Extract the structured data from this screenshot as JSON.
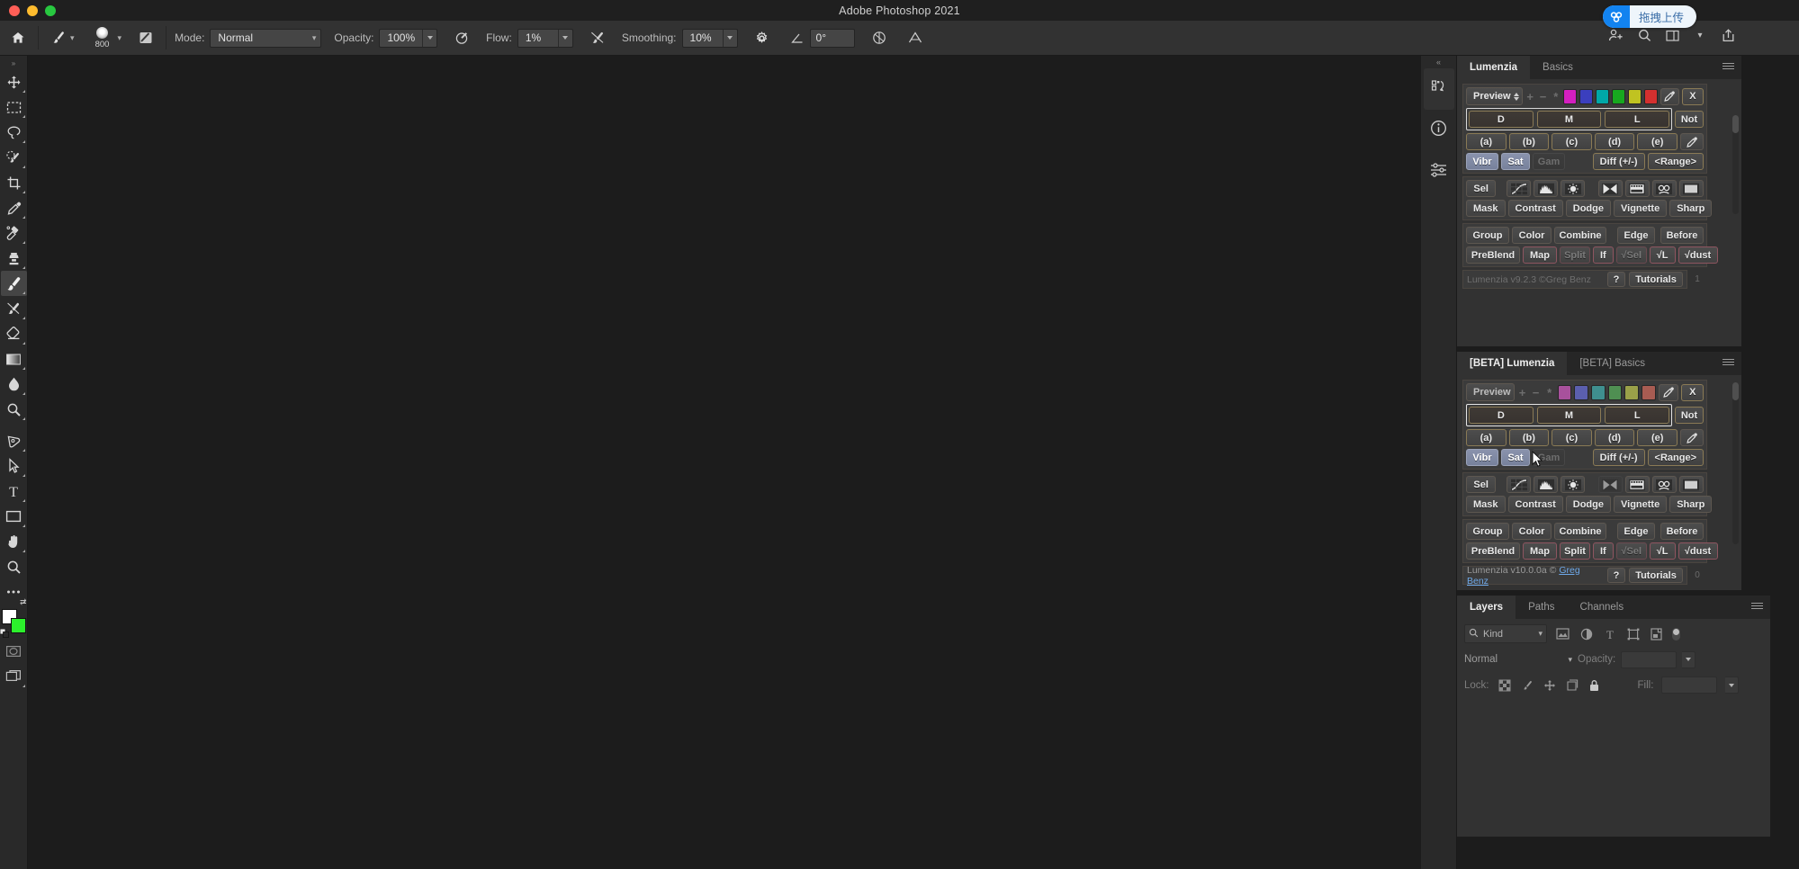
{
  "window": {
    "title": "Adobe Photoshop 2021",
    "traffic_lights": [
      "close",
      "minimize",
      "maximize"
    ]
  },
  "options_bar": {
    "home_icon": "home-icon",
    "brush_preset_icon": "brush-preset-icon",
    "brush_size": "800",
    "brush_panel_icon": "brush-settings-panel-icon",
    "mode_label": "Mode:",
    "mode_value": "Normal",
    "opacity_label": "Opacity:",
    "opacity_value": "100%",
    "pressure_opacity_icon": "pressure-controls-opacity-icon",
    "flow_label": "Flow:",
    "flow_value": "1%",
    "airbrush_icon": "airbrush-icon",
    "smoothing_label": "Smoothing:",
    "smoothing_value": "10%",
    "smoothing_options_icon": "gear-icon",
    "angle_icon": "brush-angle-icon",
    "angle_value": "0°",
    "symmetry_icon": "symmetry-icon",
    "tablet_pressure_icon": "tablet-pressure-size-icon"
  },
  "top_right": {
    "upload_label": "拖拽上传",
    "upload_brand_icon": "cloud-upload-icon",
    "icons": [
      {
        "name": "add-collaborator-icon"
      },
      {
        "name": "search-icon"
      },
      {
        "name": "workspace-switcher-icon"
      },
      {
        "name": "chevron-down-icon"
      },
      {
        "name": "share-export-icon"
      }
    ]
  },
  "toolbar": {
    "collapse_icon": "expand-toolbar-icon",
    "tools": [
      {
        "name": "move-tool",
        "icon": "move-icon",
        "active": false
      },
      {
        "name": "rectangular-marquee-tool",
        "icon": "marquee-icon",
        "active": false
      },
      {
        "name": "lasso-tool",
        "icon": "lasso-icon",
        "active": false
      },
      {
        "name": "object-selection-tool",
        "icon": "quick-selection-icon",
        "active": false
      },
      {
        "name": "crop-tool",
        "icon": "crop-icon",
        "active": false
      },
      {
        "name": "eyedropper-tool",
        "icon": "eyedropper-icon",
        "active": false
      },
      {
        "name": "spot-healing-brush-tool",
        "icon": "healing-brush-icon",
        "active": false
      },
      {
        "name": "clone-stamp-tool",
        "icon": "clone-stamp-icon",
        "active": false
      },
      {
        "name": "brush-tool",
        "icon": "brush-icon",
        "active": true
      },
      {
        "name": "history-brush-tool",
        "icon": "history-brush-icon",
        "active": false
      },
      {
        "name": "eraser-tool",
        "icon": "eraser-icon",
        "active": false
      },
      {
        "name": "gradient-tool",
        "icon": "gradient-icon",
        "active": false
      },
      {
        "name": "blur-tool",
        "icon": "blur-drop-icon",
        "active": false
      },
      {
        "name": "dodge-tool",
        "icon": "dodge-icon",
        "active": false
      },
      {
        "name": "pen-tool",
        "icon": "pen-icon",
        "active": false
      },
      {
        "name": "path-selection-tool",
        "icon": "path-arrow-icon",
        "active": false
      },
      {
        "name": "type-tool",
        "icon": "type-icon",
        "active": false
      },
      {
        "name": "rectangle-tool",
        "icon": "rectangle-icon",
        "active": false
      },
      {
        "name": "hand-tool",
        "icon": "hand-icon",
        "active": false
      },
      {
        "name": "zoom-tool",
        "icon": "magnifier-icon",
        "active": false
      },
      {
        "name": "edit-toolbar",
        "icon": "ellipsis-icon",
        "active": false
      }
    ],
    "foreground_color": "#ffffff",
    "background_color": "#2cf02c",
    "swap_colors_icon": "swap-colors-icon",
    "default_colors_icon": "default-colors-icon",
    "quick_mask_icon": "quick-mask-icon",
    "screen_mode_icon": "screen-mode-icon"
  },
  "rail": {
    "collapse_icon": "collapse-panels-icon",
    "buttons": [
      {
        "name": "actions-panel-icon",
        "selected": false
      },
      {
        "name": "info-panel-icon",
        "selected": false
      },
      {
        "name": "properties-panel-icon",
        "selected": false
      }
    ]
  },
  "lumenzia": {
    "tabs": [
      {
        "label": "Lumenzia",
        "active": true
      },
      {
        "label": "Basics",
        "active": false
      }
    ],
    "menu_icon": "panel-menu-icon",
    "preview_label": "Preview",
    "plus": "+",
    "minus": "−",
    "asterisk": "*",
    "swatch_colors": [
      "#d41fc0",
      "#3b3fbe",
      "#00a8a8",
      "#17a81f",
      "#c0c321",
      "#d4302f"
    ],
    "dropper_icon": "eyedropper-icon",
    "clear_label": "X",
    "zones": [
      "D",
      "M",
      "L"
    ],
    "not_label": "Not",
    "sublevels": [
      "(a)",
      "(b)",
      "(c)",
      "(d)",
      "(e)"
    ],
    "sample_icon": "eyedropper-icon",
    "vibr_label": "Vibr",
    "sat_label": "Sat",
    "gam_label": "Gam",
    "diff_label": "Diff (+/-)",
    "range_label": "<Range>",
    "sel_label": "Sel",
    "adjust_icons": [
      "curves-icon",
      "levels-icon",
      "brightness-contrast-icon",
      "gradient-map-icon",
      "film-strip-icon",
      "color-balance-icon",
      "solid-color-icon"
    ],
    "mask_row": [
      "Mask",
      "Contrast",
      "Dodge",
      "Vignette",
      "Sharp"
    ],
    "group_row": [
      "Group",
      "Color",
      "Combine",
      "Edge",
      "Before"
    ],
    "preblend_row": [
      "PreBlend",
      "Map",
      "Split",
      "If",
      "√Sel",
      "√L",
      "√dust"
    ],
    "version": "Lumenzia v9.2.3 ©Greg Benz",
    "help_label": "?",
    "tutorials_label": "Tutorials",
    "counter": "1"
  },
  "lumenzia_beta": {
    "tabs": [
      {
        "label": "[BETA] Lumenzia",
        "active": true
      },
      {
        "label": "[BETA] Basics",
        "active": false
      }
    ],
    "menu_icon": "panel-menu-icon",
    "preview_label": "Preview",
    "plus": "+",
    "minus": "−",
    "asterisk": "*",
    "swatch_colors": [
      "#a8519c",
      "#5b5fae",
      "#3f8f8f",
      "#4f8f52",
      "#9aa049",
      "#a85c52"
    ],
    "dropper_icon": "eyedropper-icon",
    "clear_label": "X",
    "zones": [
      "D",
      "M",
      "L"
    ],
    "not_label": "Not",
    "sublevels": [
      "(a)",
      "(b)",
      "(c)",
      "(d)",
      "(e)"
    ],
    "sample_icon": "eyedropper-icon",
    "vibr_label": "Vibr",
    "sat_label": "Sat",
    "gam_label": "Gam",
    "diff_label": "Diff (+/-)",
    "range_label": "<Range>",
    "sel_label": "Sel",
    "adjust_icons": [
      "curves-icon",
      "levels-icon",
      "brightness-contrast-icon",
      "gradient-map-icon",
      "film-strip-icon",
      "color-balance-icon",
      "solid-color-icon"
    ],
    "mask_row": [
      "Mask",
      "Contrast",
      "Dodge",
      "Vignette",
      "Sharp"
    ],
    "group_row": [
      "Group",
      "Color",
      "Combine",
      "Edge",
      "Before"
    ],
    "preblend_row": [
      "PreBlend",
      "Map",
      "Split",
      "If",
      "√Sel",
      "√L",
      "√dust"
    ],
    "version_prefix": "Lumenzia v10.0.0a © ",
    "version_link": "Greg Benz",
    "help_label": "?",
    "tutorials_label": "Tutorials",
    "counter": "0"
  },
  "layers": {
    "tabs": [
      {
        "label": "Layers",
        "active": true
      },
      {
        "label": "Paths",
        "active": false
      },
      {
        "label": "Channels",
        "active": false
      }
    ],
    "menu_icon": "panel-menu-icon",
    "filter_search_icon": "search-icon",
    "filter_kind": "Kind",
    "filter_icons": [
      "pixel-layer-filter-icon",
      "adjustment-layer-filter-icon",
      "type-layer-filter-icon",
      "shape-layer-filter-icon",
      "smart-object-filter-icon"
    ],
    "filter_toggle_icon": "filter-enable-toggle",
    "blend_mode": "Normal",
    "opacity_label": "Opacity:",
    "opacity_value": "",
    "lock_label": "Lock:",
    "lock_icons": [
      "lock-transparent-pixels-icon",
      "lock-image-pixels-icon",
      "lock-position-icon",
      "lock-artboard-nesting-icon",
      "lock-all-icon"
    ],
    "fill_label": "Fill:",
    "fill_value": ""
  }
}
